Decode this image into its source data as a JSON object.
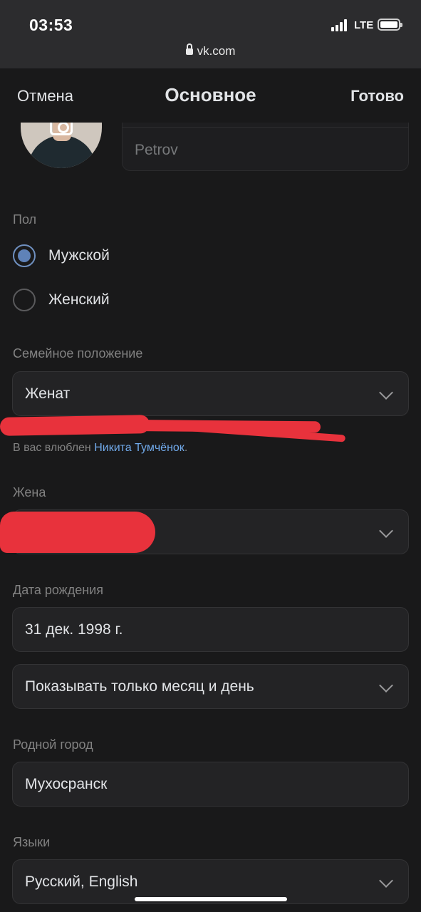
{
  "status": {
    "time": "03:53",
    "network": "LTE",
    "url": "vk.com"
  },
  "header": {
    "cancel": "Отмена",
    "title": "Основное",
    "done": "Готово"
  },
  "profile": {
    "last_name": "Petrov"
  },
  "gender": {
    "label": "Пол",
    "options": [
      {
        "label": "Мужской",
        "selected": true
      },
      {
        "label": "Женский",
        "selected": false
      }
    ]
  },
  "relationship": {
    "label": "Семейное положение",
    "value": "Женат",
    "note_prefix": "В вас влюблен ",
    "note_link": "Никита Тумчёнок",
    "note_suffix": "."
  },
  "partner": {
    "label": "Жена",
    "value": ""
  },
  "birthday": {
    "label": "Дата рождения",
    "value": "31 дек. 1998 г.",
    "visibility": "Показывать только месяц и день"
  },
  "hometown": {
    "label": "Родной город",
    "value": "Мухосранск"
  },
  "languages": {
    "label": "Языки",
    "value": "Русский, English"
  },
  "colors": {
    "background": "#19191a",
    "field": "#232325",
    "link": "#71aaeb",
    "radio_accent": "#5f82b8",
    "redaction": "#e8323c"
  }
}
